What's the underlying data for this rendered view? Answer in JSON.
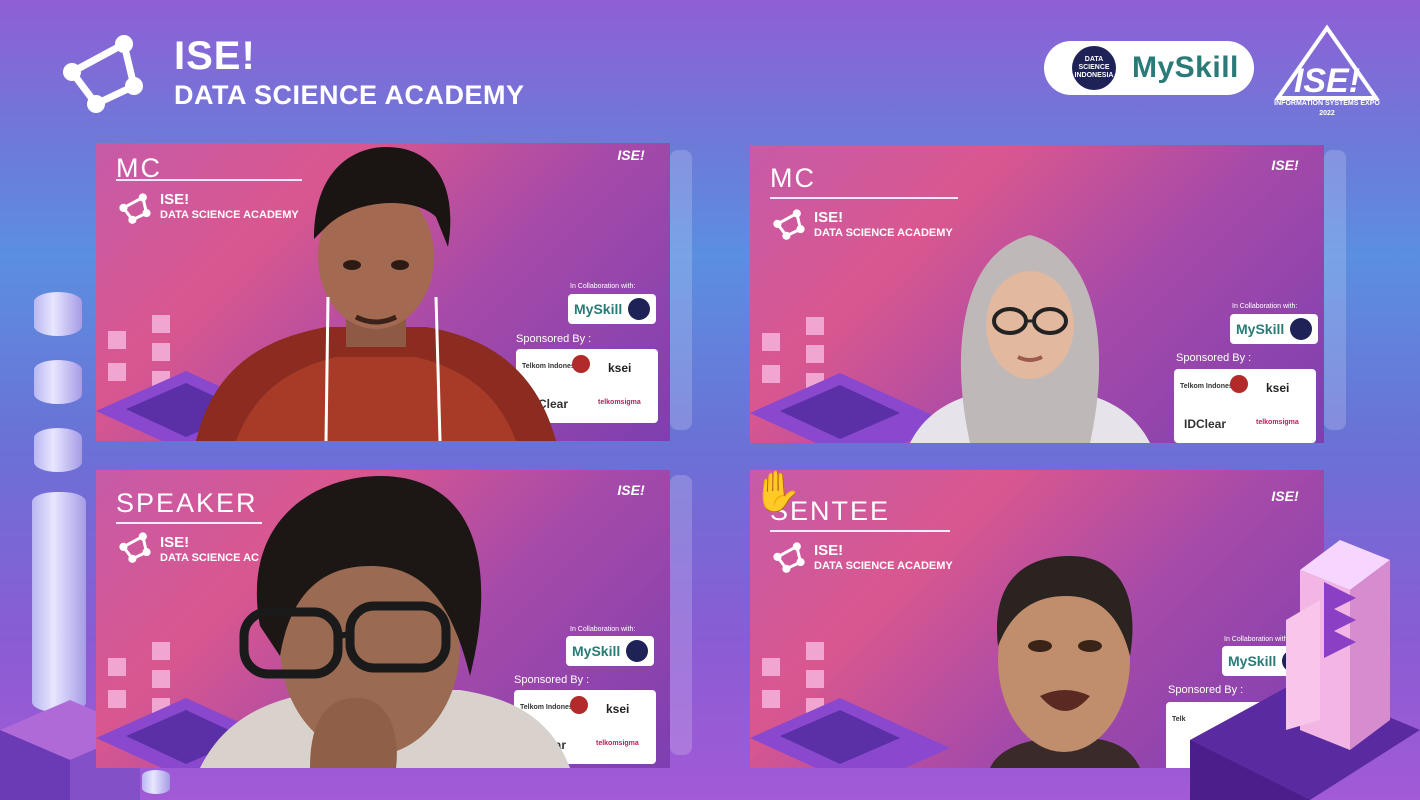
{
  "header": {
    "brand_title": "ISE!",
    "brand_subtitle": "DATA SCIENCE ACADEMY",
    "partner_badge_small": "DATA SCIENCE INDONESIA",
    "partner_name": "MySkill",
    "event_logo_title": "ISE!",
    "event_logo_line1": "INFORMATION SYSTEMS EXPO",
    "event_logo_line2": "2022"
  },
  "tiles": [
    {
      "role": "MC",
      "brand_title": "ISE!",
      "brand_subtitle": "DATA SCIENCE ACADEMY",
      "collab_label": "In Collaboration with:",
      "collab_name": "MySkill",
      "sponsor_label": "Sponsored By :",
      "sponsor_1": "Telkom Indonesia",
      "sponsor_2": "ksei",
      "sponsor_3": "IDClear",
      "sponsor_4": "telkomsigma",
      "corner_logo": "ISE!"
    },
    {
      "role": "MC",
      "brand_title": "ISE!",
      "brand_subtitle": "DATA SCIENCE ACADEMY",
      "collab_label": "In Collaboration with:",
      "collab_name": "MySkill",
      "sponsor_label": "Sponsored By :",
      "sponsor_1": "Telkom Indonesia",
      "sponsor_2": "ksei",
      "sponsor_3": "IDClear",
      "sponsor_4": "telkomsigma",
      "corner_logo": "ISE!"
    },
    {
      "role": "SPEAKER",
      "brand_title": "ISE!",
      "brand_subtitle": "DATA SCIENCE AC",
      "collab_label": "In Collaboration with:",
      "collab_name": "MySkill",
      "sponsor_label": "Sponsored By :",
      "sponsor_1": "Telkom Indonesia",
      "sponsor_2": "ksei",
      "sponsor_3": "IDClear",
      "sponsor_4": "telkomsigma",
      "corner_logo": "ISE!"
    },
    {
      "role": "SENTEE",
      "brand_title": "ISE!",
      "brand_subtitle": "DATA SCIENCE ACADEMY",
      "collab_label": "In Collaboration with:",
      "collab_name": "MySkill",
      "sponsor_label": "Sponsored By :",
      "sponsor_1": "Telk",
      "sponsor_2": "",
      "sponsor_3": "",
      "sponsor_4": "",
      "corner_logo": "ISE!",
      "raised_hand": "✋"
    }
  ],
  "colors": {
    "tile_pink": "#d9578f",
    "tile_purple": "#7d3fb0",
    "myskill_teal": "#2a7a78",
    "dsi_navy": "#1e2257"
  }
}
